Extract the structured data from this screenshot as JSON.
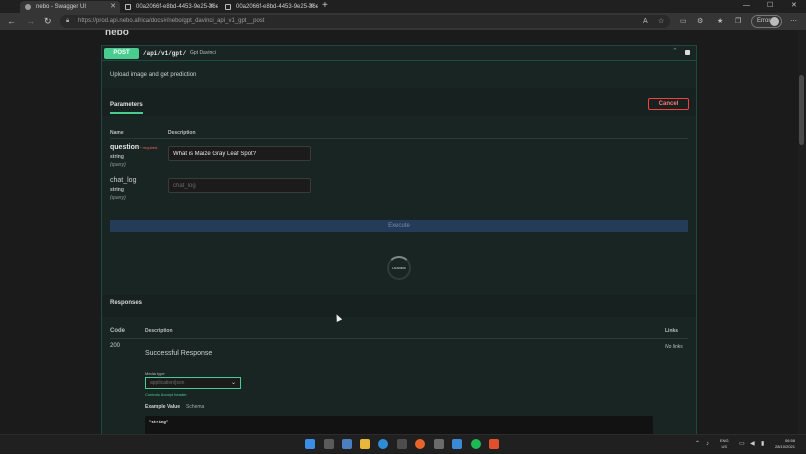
{
  "browser": {
    "tabs": [
      {
        "label": "nebo - Swagger UI",
        "active": true
      },
      {
        "label": "00a2066f-e8bd-4453-9e25-36ec",
        "active": false
      },
      {
        "label": "00a2066f-e8bd-4453-9e25-36ec",
        "active": false
      }
    ],
    "url": "https://prod.api.nebo.africa/docs#/nebo/gpt_davinci_api_v1_gpt__post",
    "profile": "Error",
    "new_tab": "+",
    "minimize": "—",
    "maximize": "☐",
    "close": "✕"
  },
  "page": {
    "brand": "nebo",
    "operation": {
      "method": "POST",
      "path": "/api/v1/gpt/",
      "summary": "Gpt Davinci",
      "description": "Upload image and get prediction"
    },
    "parameters": {
      "tab_label": "Parameters",
      "cancel_label": "Cancel",
      "col_name": "Name",
      "col_description": "Description",
      "items": [
        {
          "name": "question",
          "required": "* required",
          "type": "string",
          "in": "(query)",
          "value": "What is Maize Gray Leaf Spot?",
          "placeholder": ""
        },
        {
          "name": "chat_log",
          "required": "",
          "type": "string",
          "in": "(query)",
          "value": "",
          "placeholder": "chat_log"
        }
      ]
    },
    "execute_label": "Execute",
    "loading_label": "LOADING",
    "responses": {
      "header": "Responses",
      "col_code": "Code",
      "col_description": "Description",
      "col_links": "Links",
      "rows": [
        {
          "code": "200",
          "description": "Successful Response",
          "links": "No links",
          "media_type_label": "Media type",
          "media_type_value": "application/json",
          "controls_accept": "Controls Accept header.",
          "example_tab": "Example Value",
          "schema_tab": "Schema",
          "example": "\"string\""
        }
      ]
    }
  },
  "taskbar": {
    "lang_line1": "ENG",
    "lang_line2": "US",
    "time": "06:58",
    "date": "28/10/2021"
  },
  "colors": {
    "post_green": "#49cc90",
    "cancel_red": "#f93e3e",
    "execute_blue": "#243c58"
  }
}
